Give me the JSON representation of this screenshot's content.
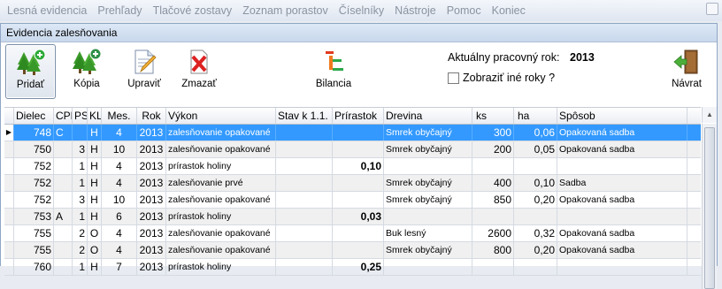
{
  "menu": [
    "Lesná evidencia",
    "Prehľady",
    "Tlačové zostavy",
    "Zoznam porastov",
    "Číselníky",
    "Nástroje",
    "Pomoc",
    "Koniec"
  ],
  "window": {
    "title": "Evidencia zalesňovania"
  },
  "toolbar": {
    "add_label": "Pridať",
    "copy_label": "Kópia",
    "edit_label": "Upraviť",
    "delete_label": "Zmazať",
    "balance_label": "Bilancia",
    "back_label": "Návrat"
  },
  "info": {
    "year_label": "Aktuálny pracovný rok:",
    "year_value": "2013",
    "other_years_label": "Zobraziť iné roky ?"
  },
  "columns": [
    "Dielec",
    "CPP",
    "PS",
    "KL",
    "Mes.",
    "Rok",
    "Výkon",
    "Stav k 1.1.",
    "Prírastok",
    "Drevina",
    "ks",
    "ha",
    "Spôsob"
  ],
  "rows": [
    {
      "dielec": "748",
      "cpp": "C",
      "ps": "",
      "kl": "H",
      "mes": "4",
      "rok": "2013",
      "vykon": "zalesňovanie opakované",
      "stav": "",
      "prir": "",
      "drev": "Smrek obyčajný",
      "ks": "300",
      "ha": "0,06",
      "sposob": "Opakovaná sadba"
    },
    {
      "dielec": "750",
      "cpp": "",
      "ps": "3",
      "kl": "H",
      "mes": "10",
      "rok": "2013",
      "vykon": "zalesňovanie opakované",
      "stav": "",
      "prir": "",
      "drev": "Smrek obyčajný",
      "ks": "200",
      "ha": "0,05",
      "sposob": "Opakovaná sadba"
    },
    {
      "dielec": "752",
      "cpp": "",
      "ps": "1",
      "kl": "H",
      "mes": "4",
      "rok": "2013",
      "vykon": "prírastok holiny",
      "stav": "",
      "prir": "0,10",
      "drev": "",
      "ks": "",
      "ha": "",
      "sposob": ""
    },
    {
      "dielec": "752",
      "cpp": "",
      "ps": "1",
      "kl": "H",
      "mes": "4",
      "rok": "2013",
      "vykon": "zalesňovanie prvé",
      "stav": "",
      "prir": "",
      "drev": "Smrek obyčajný",
      "ks": "400",
      "ha": "0,10",
      "sposob": "Sadba"
    },
    {
      "dielec": "752",
      "cpp": "",
      "ps": "3",
      "kl": "H",
      "mes": "10",
      "rok": "2013",
      "vykon": "zalesňovanie opakované",
      "stav": "",
      "prir": "",
      "drev": "Smrek obyčajný",
      "ks": "850",
      "ha": "0,20",
      "sposob": "Opakovaná sadba"
    },
    {
      "dielec": "753",
      "cpp": "A",
      "ps": "1",
      "kl": "H",
      "mes": "6",
      "rok": "2013",
      "vykon": "prírastok holiny",
      "stav": "",
      "prir": "0,03",
      "drev": "",
      "ks": "",
      "ha": "",
      "sposob": ""
    },
    {
      "dielec": "755",
      "cpp": "",
      "ps": "2",
      "kl": "O",
      "mes": "4",
      "rok": "2013",
      "vykon": "zalesňovanie opakované",
      "stav": "",
      "prir": "",
      "drev": "Buk lesný",
      "ks": "2600",
      "ha": "0,32",
      "sposob": "Opakovaná sadba"
    },
    {
      "dielec": "755",
      "cpp": "",
      "ps": "2",
      "kl": "O",
      "mes": "4",
      "rok": "2013",
      "vykon": "zalesňovanie opakované",
      "stav": "",
      "prir": "",
      "drev": "Smrek obyčajný",
      "ks": "800",
      "ha": "0,20",
      "sposob": "Opakovaná sadba"
    },
    {
      "dielec": "760",
      "cpp": "",
      "ps": "1",
      "kl": "H",
      "mes": "7",
      "rok": "2013",
      "vykon": "prírastok holiny",
      "stav": "",
      "prir": "0,25",
      "drev": "",
      "ks": "",
      "ha": "",
      "sposob": ""
    }
  ],
  "colors": {
    "selection": "#3399ff",
    "alt_row": "#f0f0f0",
    "menu_text": "#8a93a0"
  }
}
